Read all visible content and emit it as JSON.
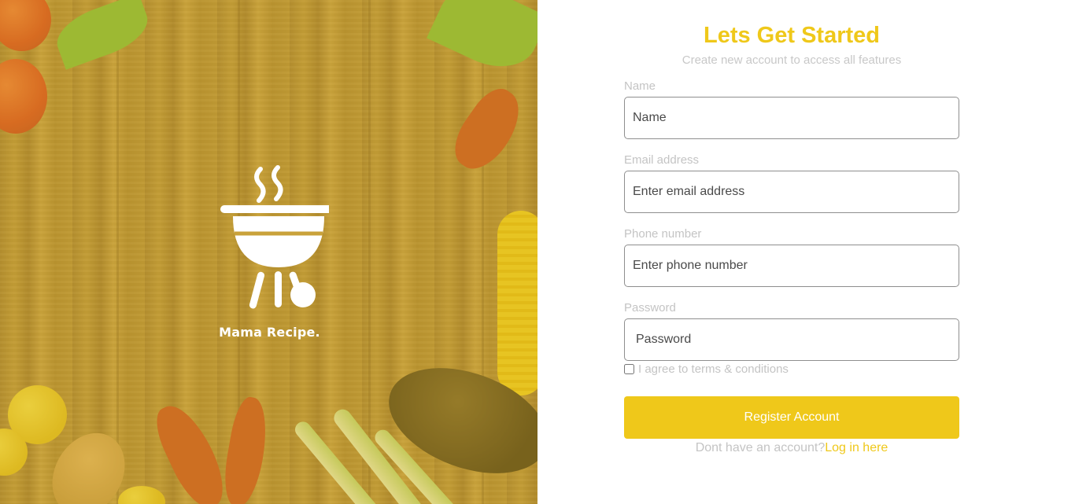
{
  "brand": {
    "name": "Mama Recipe.",
    "logo_icon": "grill-icon",
    "accent_color": "#efc81a"
  },
  "form": {
    "title": "Lets Get Started",
    "subtitle": "Create new account to access all features",
    "fields": [
      {
        "label": "Name",
        "placeholder": "Name"
      },
      {
        "label": "Email address",
        "placeholder": "Enter email address"
      },
      {
        "label": "Phone number",
        "placeholder": "Enter phone number"
      },
      {
        "label": "Password",
        "placeholder": "Password"
      }
    ],
    "terms_label": "I agree to terms & conditions",
    "terms_checked": false,
    "register_label": "Register Account",
    "login_prompt": "Dont have an account?",
    "login_link": "Log in here"
  }
}
